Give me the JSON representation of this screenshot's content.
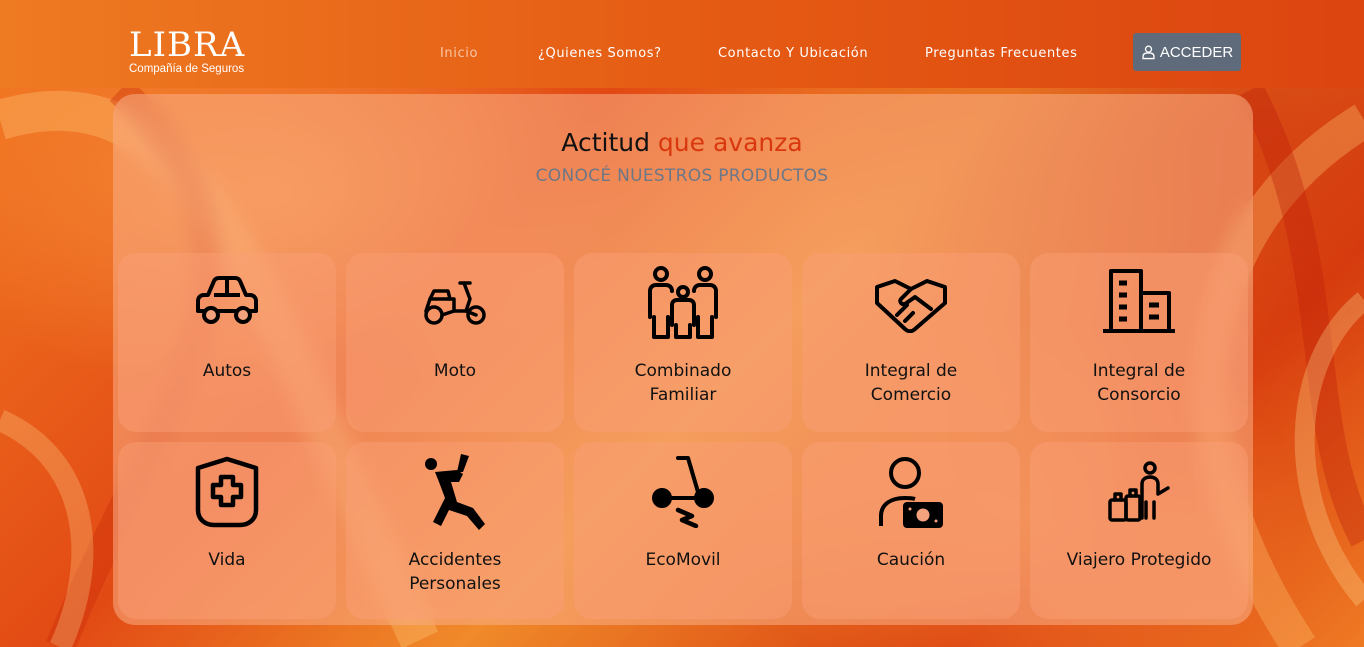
{
  "brand": {
    "name": "LIBRA",
    "tagline": "Compañía de Seguros"
  },
  "nav": {
    "items": [
      {
        "label": "Inicio",
        "active": true
      },
      {
        "label": "¿Quienes Somos?"
      },
      {
        "label": "Contacto Y Ubicación"
      },
      {
        "label": "Preguntas Frecuentes"
      }
    ],
    "login_label": "ACCEDER",
    "login_icon": "user-icon"
  },
  "hero": {
    "title_plain": "Actitud",
    "title_accent": "que avanza",
    "subtitle": "CONOCÉ NUESTROS PRODUCTOS"
  },
  "colors": {
    "accent": "#d9380e",
    "subtitle": "#6d7786",
    "button": "#5f6b7a",
    "nav_active": "#f9c6a6"
  },
  "products": [
    {
      "line1": "Autos",
      "line2": "",
      "icon": "car-icon"
    },
    {
      "line1": "Moto",
      "line2": "",
      "icon": "scooter-icon"
    },
    {
      "line1": "Combinado",
      "line2": "Familiar",
      "icon": "family-icon"
    },
    {
      "line1": "Integral de",
      "line2": "Comercio",
      "icon": "handshake-icon"
    },
    {
      "line1": "Integral de",
      "line2": "Consorcio",
      "icon": "building-icon"
    },
    {
      "line1": "Vida",
      "line2": "",
      "icon": "health-shield-icon"
    },
    {
      "line1": "Accidentes",
      "line2": "Personales",
      "icon": "falling-person-icon"
    },
    {
      "line1": "EcoMovil",
      "line2": "",
      "icon": "electric-scooter-icon"
    },
    {
      "line1": "Caución",
      "line2": "",
      "icon": "person-money-icon"
    },
    {
      "line1": "Viajero Protegido",
      "line2": "",
      "icon": "traveler-icon"
    }
  ]
}
